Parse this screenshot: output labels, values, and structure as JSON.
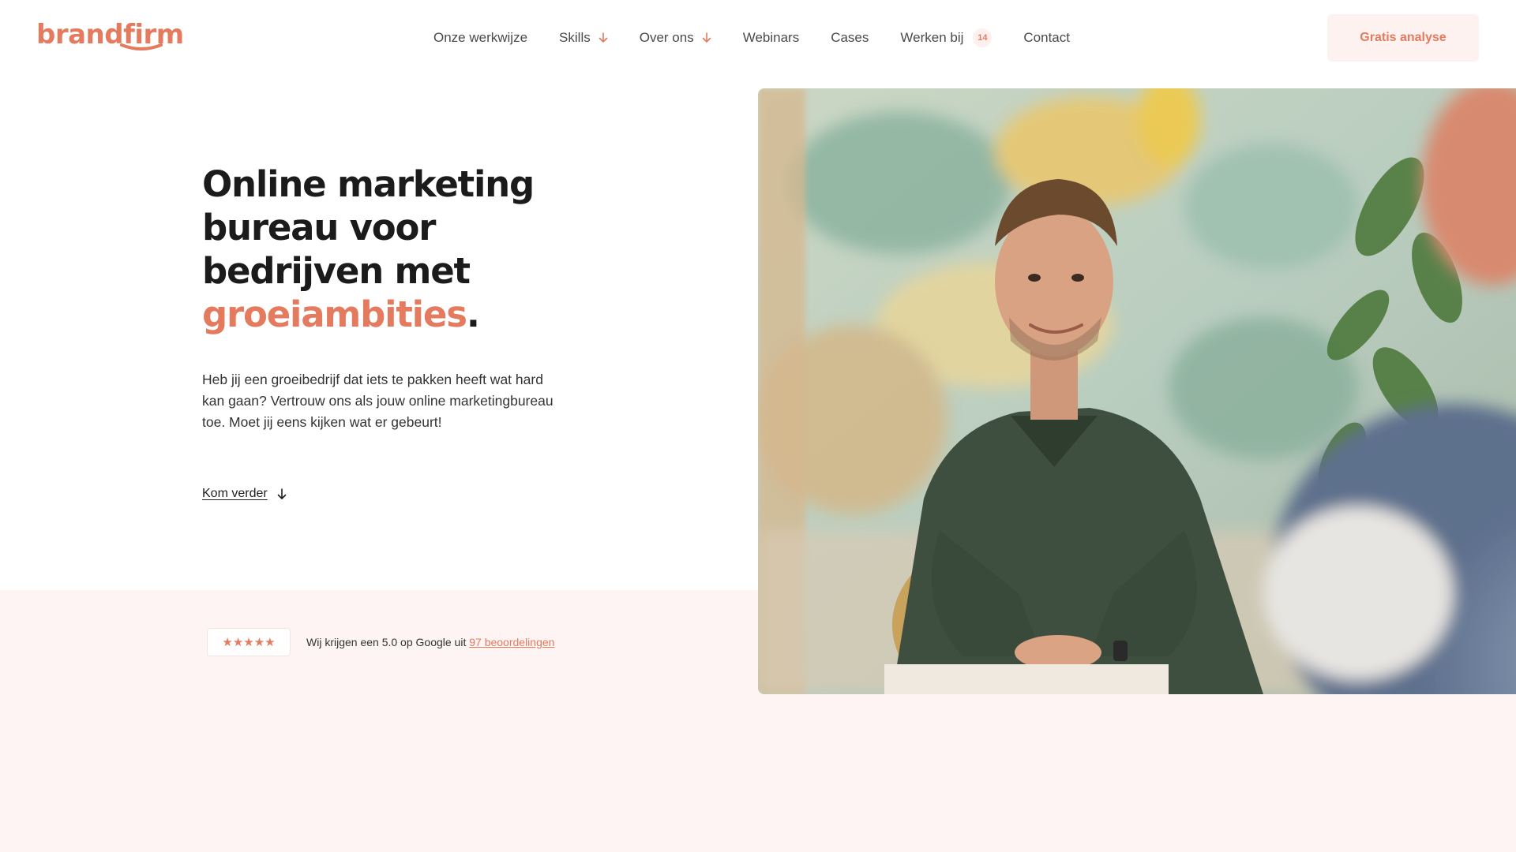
{
  "brand": {
    "logo_text": "brandfirm",
    "accent_color": "#e47a5e",
    "pink_bg": "#fdf4f3"
  },
  "nav": {
    "items": [
      {
        "label": "Onze werkwijze",
        "has_arrow": false
      },
      {
        "label": "Skills",
        "has_arrow": true
      },
      {
        "label": "Over ons",
        "has_arrow": true
      },
      {
        "label": "Webinars",
        "has_arrow": false
      },
      {
        "label": "Cases",
        "has_arrow": false
      },
      {
        "label": "Werken bij",
        "badge": "14"
      },
      {
        "label": "Contact",
        "has_arrow": false
      }
    ],
    "cta_label": "Gratis analyse"
  },
  "hero": {
    "title_line1": "Online marketing",
    "title_line2": "bureau voor",
    "title_line3": "bedrijven met",
    "title_accent": "groeiambities",
    "title_period": ".",
    "text": "Heb jij een groeibedrijf dat iets te pakken heeft wat hard kan gaan? Vertrouw ons als jouw online marketingbureau toe. Moet jij eens kijken wat er gebeurt!",
    "link_label": "Kom verder"
  },
  "rating": {
    "stars": "★★★★★",
    "text": "Wij krijgen een 5.0 op Google uit ",
    "link_label": "97 beoordelingen"
  },
  "photo": {
    "subject": "smiling man in green polo seated in office"
  }
}
